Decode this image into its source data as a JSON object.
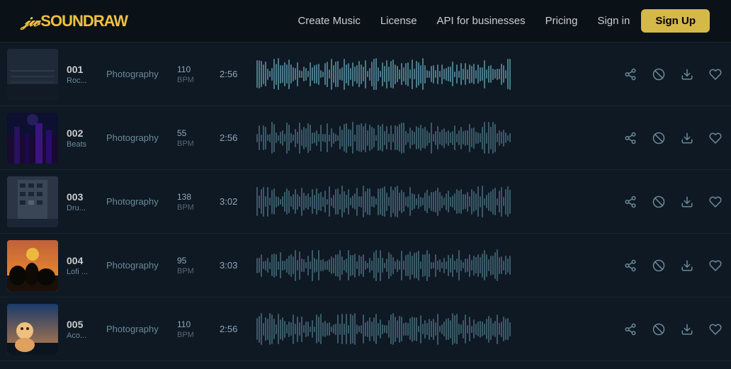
{
  "nav": {
    "logo": "SOUNDRAW",
    "links": [
      {
        "label": "Create Music",
        "href": "#"
      },
      {
        "label": "License",
        "href": "#"
      },
      {
        "label": "API for businesses",
        "href": "#"
      },
      {
        "label": "Pricing",
        "href": "#"
      }
    ],
    "signin_label": "Sign in",
    "signup_label": "Sign Up"
  },
  "tracks": [
    {
      "number": "001",
      "subtitle": "Roc...",
      "genre": "Photography",
      "bpm": "110",
      "bpm_label": "BPM",
      "duration": "2:56",
      "thumb_class": "thumb-001"
    },
    {
      "number": "002",
      "subtitle": "Beats",
      "genre": "Photography",
      "bpm": "55",
      "bpm_label": "BPM",
      "duration": "2:56",
      "thumb_class": "thumb-002"
    },
    {
      "number": "003",
      "subtitle": "Dru...",
      "genre": "Photography",
      "bpm": "138",
      "bpm_label": "BPM",
      "duration": "3:02",
      "thumb_class": "thumb-003"
    },
    {
      "number": "004",
      "subtitle": "Lofi ...",
      "genre": "Photography",
      "bpm": "95",
      "bpm_label": "BPM",
      "duration": "3:03",
      "thumb_class": "thumb-004"
    },
    {
      "number": "005",
      "subtitle": "Aco...",
      "genre": "Photography",
      "bpm": "110",
      "bpm_label": "BPM",
      "duration": "2:56",
      "thumb_class": "thumb-005"
    }
  ]
}
